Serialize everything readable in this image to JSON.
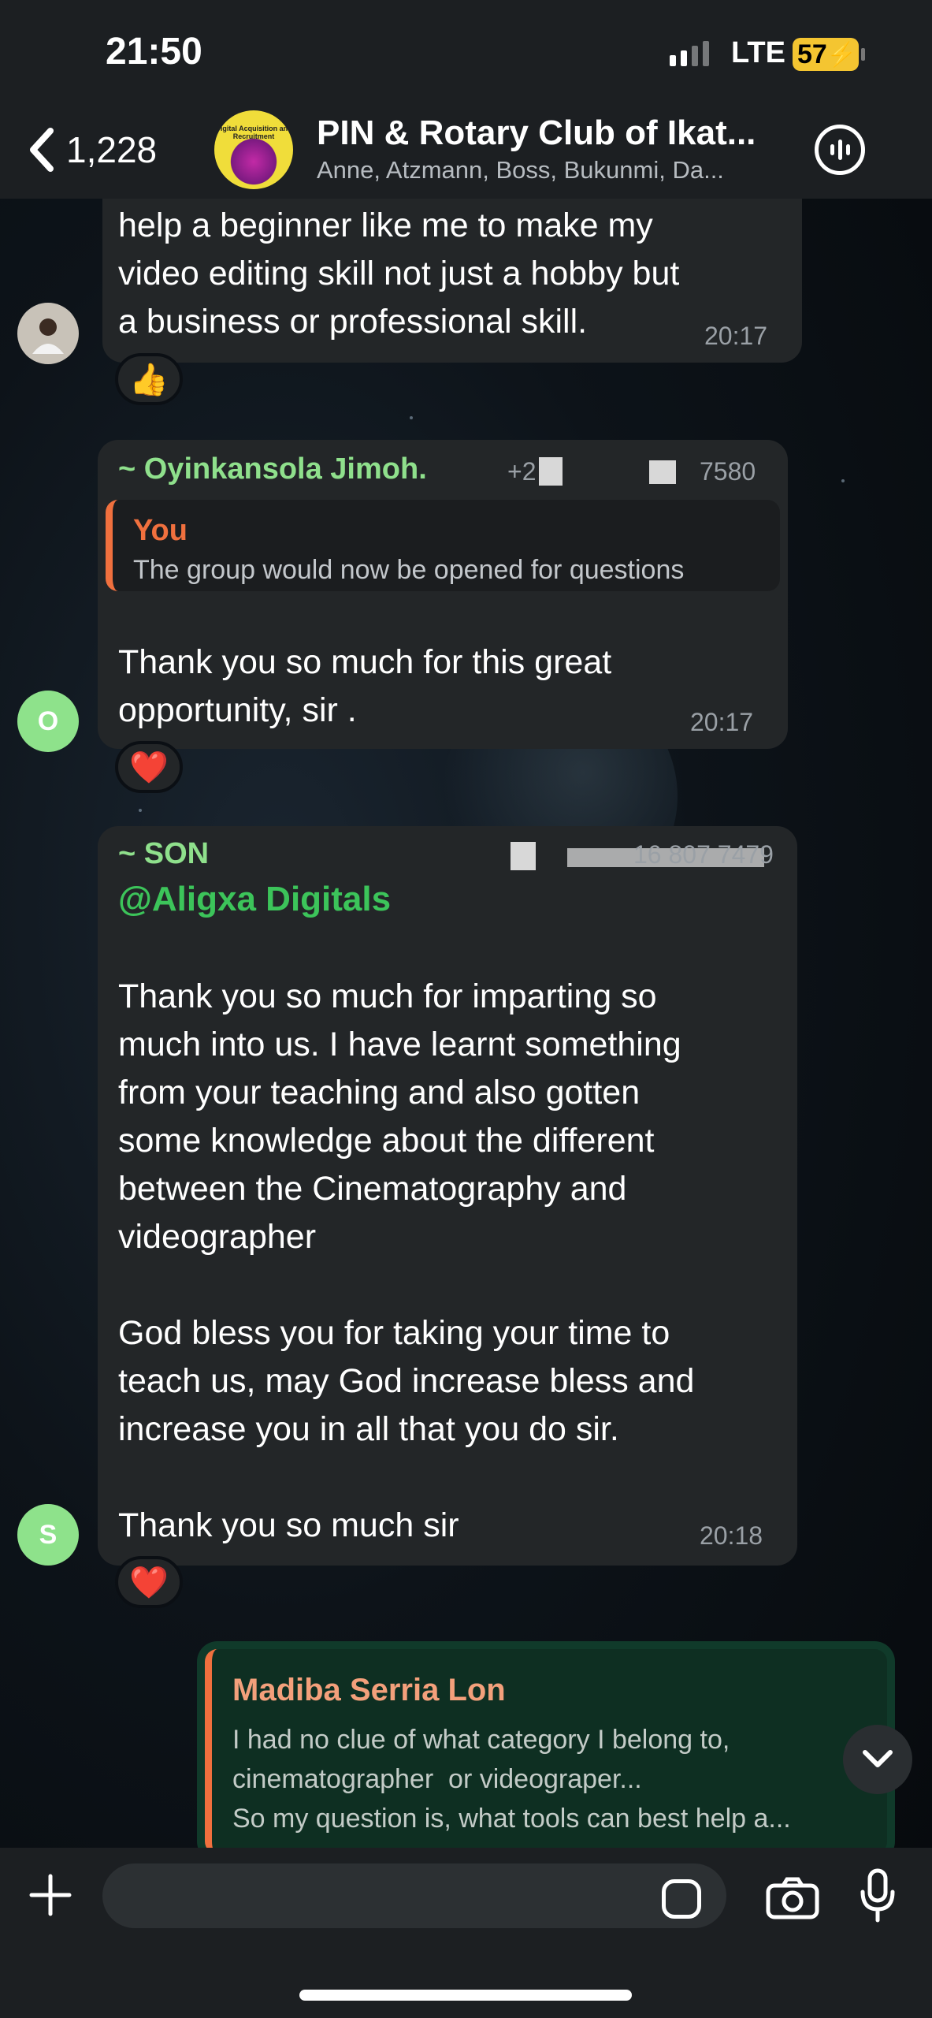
{
  "status_bar": {
    "time": "21:50",
    "network": "LTE",
    "battery": "57"
  },
  "header": {
    "back_count": "1,228",
    "group_avatar_text": "Digital Acquisition and Recruitment",
    "title": "PIN & Rotary Club of Ikat...",
    "subtitle": "Anne, Atzmann, Boss, Bukunmi, Da..."
  },
  "messages": [
    {
      "text": "help a beginner like me to make my\nvideo editing skill not just a hobby but\na business or professional skill.",
      "time": "20:17",
      "reaction": "👍"
    },
    {
      "sender": "~ Oyinkansola Jimoh.",
      "sender_color": "#8fe08c",
      "phone": "7580",
      "phone_prefix": "+2",
      "avatar_letter": "O",
      "quote_author": "You",
      "quote_text": "The group would now be opened for questions",
      "text": "Thank you so much for this great\nopportunity, sir .",
      "time": "20:17",
      "reaction": "❤️"
    },
    {
      "sender": "~ SON",
      "sender_color": "#8fe08c",
      "phone": "16 807 7479",
      "avatar_letter": "S",
      "mention": "@Aligxa Digitals",
      "text": "Thank you so much for imparting so\nmuch into us. I have learnt something\nfrom your teaching and also gotten\nsome knowledge about the different\nbetween the Cinematography and\nvideographer\n\nGod bless you for taking your time to\nteach us, may God increase bless and\nincrease you in all that you do sir.\n\nThank you so much sir",
      "time": "20:18",
      "reaction": "❤️"
    },
    {
      "quote_author": "Madiba Serria Lon",
      "quote_text": "I had no clue of what category I belong to,\ncinematographer  or videograper...\nSo my question is, what tools can best help a..."
    }
  ],
  "colors": {
    "outgoing": "#103a2a",
    "incoming": "#232628",
    "accent_orange": "#f0703e",
    "mention_green": "#3cc45a"
  }
}
